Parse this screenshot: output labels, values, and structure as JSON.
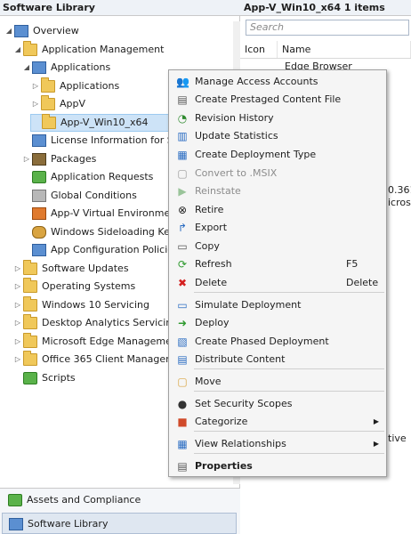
{
  "left": {
    "header": "Software Library",
    "tree": [
      {
        "label": "Overview",
        "level": 0,
        "arrow": "open",
        "icon": "overview"
      },
      {
        "label": "Application Management",
        "level": 1,
        "arrow": "open",
        "icon": "folder"
      },
      {
        "label": "Applications",
        "level": 2,
        "arrow": "open",
        "icon": "apps"
      },
      {
        "label": "Applications",
        "level": 3,
        "arrow": "closed",
        "icon": "folder"
      },
      {
        "label": "AppV",
        "level": 3,
        "arrow": "closed",
        "icon": "folder"
      },
      {
        "label": "App-V_Win10_x64",
        "level": 3,
        "arrow": "none",
        "icon": "folder",
        "selected": true
      },
      {
        "label": "License Information for Store A",
        "level": 2,
        "arrow": "none",
        "icon": "license"
      },
      {
        "label": "Packages",
        "level": 2,
        "arrow": "closed",
        "icon": "packages"
      },
      {
        "label": "Application Requests",
        "level": 2,
        "arrow": "none",
        "icon": "requests"
      },
      {
        "label": "Global Conditions",
        "level": 2,
        "arrow": "none",
        "icon": "conditions"
      },
      {
        "label": "App-V Virtual Environments",
        "level": 2,
        "arrow": "none",
        "icon": "appv-env"
      },
      {
        "label": "Windows Sideloading Keys",
        "level": 2,
        "arrow": "none",
        "icon": "keys"
      },
      {
        "label": "App Configuration Policies",
        "level": 2,
        "arrow": "none",
        "icon": "policies"
      },
      {
        "label": "Software Updates",
        "level": 1,
        "arrow": "closed",
        "icon": "folder"
      },
      {
        "label": "Operating Systems",
        "level": 1,
        "arrow": "closed",
        "icon": "folder"
      },
      {
        "label": "Windows 10 Servicing",
        "level": 1,
        "arrow": "closed",
        "icon": "folder"
      },
      {
        "label": "Desktop Analytics Servicing",
        "level": 1,
        "arrow": "closed",
        "icon": "folder"
      },
      {
        "label": "Microsoft Edge Management",
        "level": 1,
        "arrow": "closed",
        "icon": "folder"
      },
      {
        "label": "Office 365 Client Management",
        "level": 1,
        "arrow": "closed",
        "icon": "folder"
      },
      {
        "label": "Scripts",
        "level": 1,
        "arrow": "none",
        "icon": "scripts"
      }
    ],
    "nav": [
      {
        "label": "Assets and Compliance",
        "active": false
      },
      {
        "label": "Software Library",
        "active": true
      }
    ]
  },
  "right": {
    "header": "App-V_Win10_x64 1 items",
    "search_placeholder": "Search",
    "columns": [
      "Icon",
      "Name"
    ],
    "row_name": "Edge Browser",
    "fragments": [
      "0.361.",
      "icrosof",
      "tive"
    ]
  },
  "menu": {
    "items": [
      {
        "label": "Manage Access Accounts",
        "icon": "👥",
        "color": "#3a6fb0"
      },
      {
        "label": "Create Prestaged Content File",
        "icon": "▤",
        "color": "#555"
      },
      {
        "label": "Revision History",
        "icon": "◔",
        "color": "#2f8a2f"
      },
      {
        "label": "Update Statistics",
        "icon": "▥",
        "color": "#2a6cc2"
      },
      {
        "label": "Create Deployment Type",
        "icon": "▦",
        "color": "#2a6cc2"
      },
      {
        "label": "Convert to .MSIX",
        "icon": "▢",
        "color": "#9a9a9a",
        "disabled": true
      },
      {
        "label": "Reinstate",
        "icon": "▶",
        "color": "#9ac49a",
        "disabled": true
      },
      {
        "label": "Retire",
        "icon": "⊗",
        "color": "#222"
      },
      {
        "label": "Export",
        "icon": "↱",
        "color": "#2a6cc2"
      },
      {
        "label": "Copy",
        "icon": "▭",
        "color": "#555"
      },
      {
        "label": "Refresh",
        "icon": "⟳",
        "color": "#2f9a2f",
        "shortcut": "F5"
      },
      {
        "label": "Delete",
        "icon": "✖",
        "color": "#d42020",
        "shortcut": "Delete"
      },
      {
        "label": "Simulate Deployment",
        "icon": "▭",
        "color": "#2a6cc2"
      },
      {
        "label": "Deploy",
        "icon": "➜",
        "color": "#2f9a2f"
      },
      {
        "label": "Create Phased Deployment",
        "icon": "▧",
        "color": "#2a6cc2"
      },
      {
        "label": "Distribute Content",
        "icon": "▤",
        "color": "#2a6cc2"
      },
      {
        "label": "Move",
        "icon": "▢",
        "color": "#d9a441"
      },
      {
        "label": "Set Security Scopes",
        "icon": "●",
        "color": "#333"
      },
      {
        "label": "Categorize",
        "icon": "■",
        "color": "#d04a2a",
        "submenu": true
      },
      {
        "label": "View Relationships",
        "icon": "▦",
        "color": "#2a6cc2",
        "submenu": true
      },
      {
        "label": "Properties",
        "icon": "▤",
        "color": "#555",
        "bold": true
      }
    ]
  }
}
